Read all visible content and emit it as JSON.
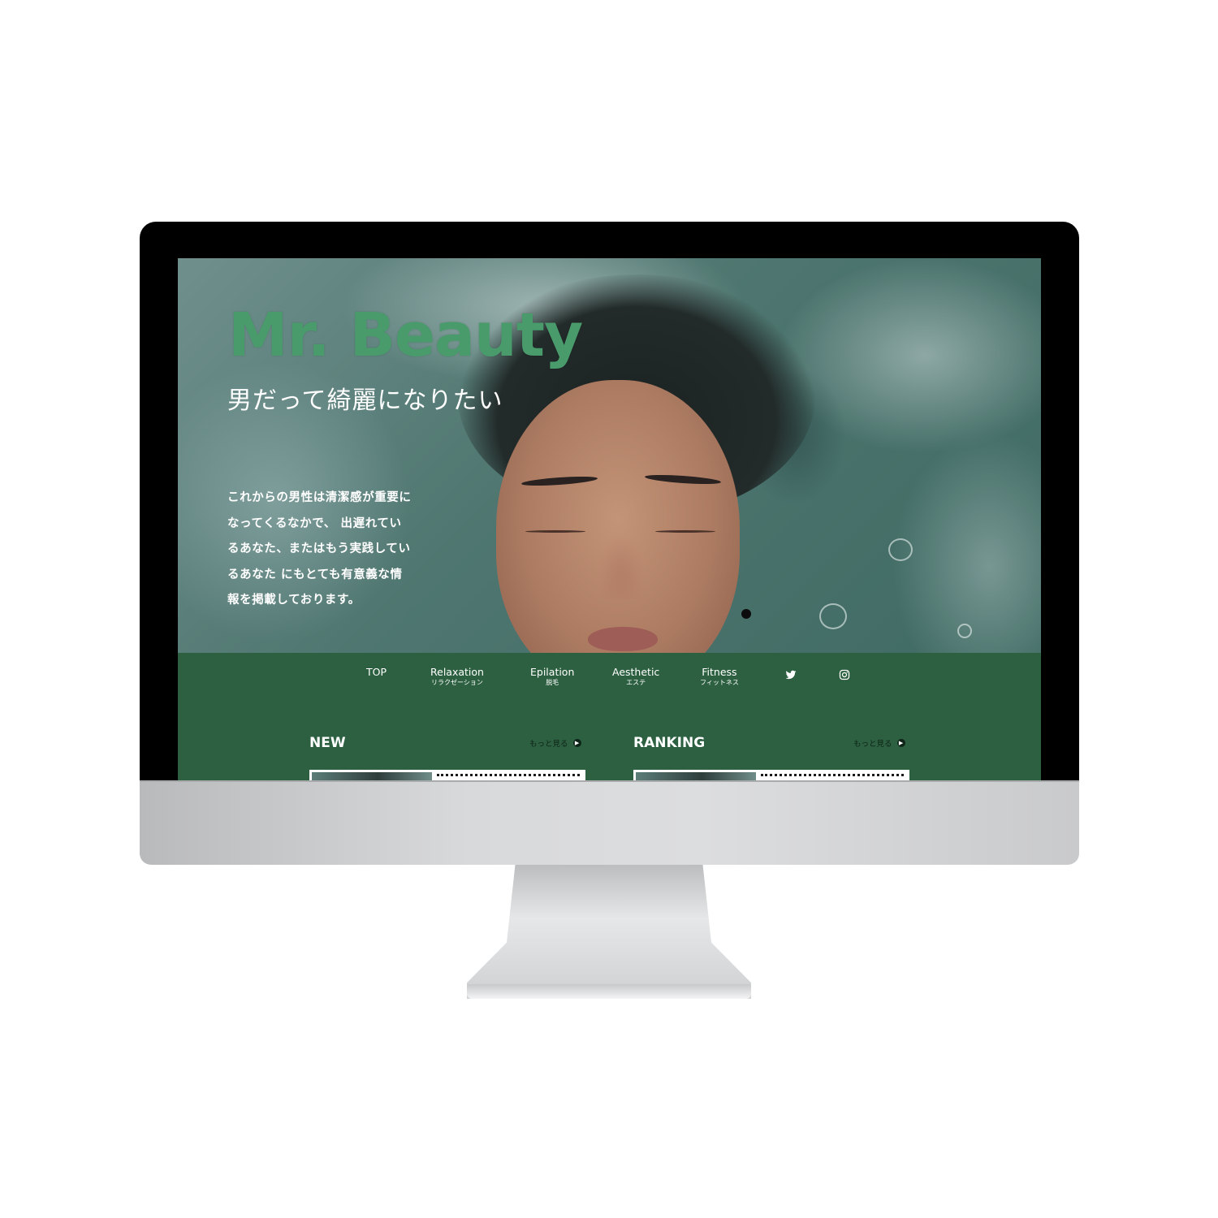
{
  "site": {
    "brand": "Mr. Beauty",
    "tagline": "男だって綺麗になりたい",
    "lead_lines": [
      "これからの男性は清潔感が重要に",
      "なってくるなかで、 出遅れてい",
      "るあなた、またはもう実践してい",
      "るあなた にもとても有意義な情",
      "報を掲載しております。"
    ]
  },
  "nav": {
    "items": [
      {
        "en": "TOP",
        "jp": ""
      },
      {
        "en": "Relaxation",
        "jp": "リラクゼーション"
      },
      {
        "en": "Epilation",
        "jp": "脱毛"
      },
      {
        "en": "Aesthetic",
        "jp": "エステ"
      },
      {
        "en": "Fitness",
        "jp": "フィットネス"
      }
    ],
    "social": [
      "twitter-icon",
      "instagram-icon"
    ]
  },
  "sections": {
    "new": {
      "title": "NEW",
      "more": "もっと見る"
    },
    "ranking": {
      "title": "RANKING",
      "more": "もっと見る"
    }
  },
  "colors": {
    "brand_green": "#4a9b6c",
    "nav_green": "#2c6041"
  }
}
